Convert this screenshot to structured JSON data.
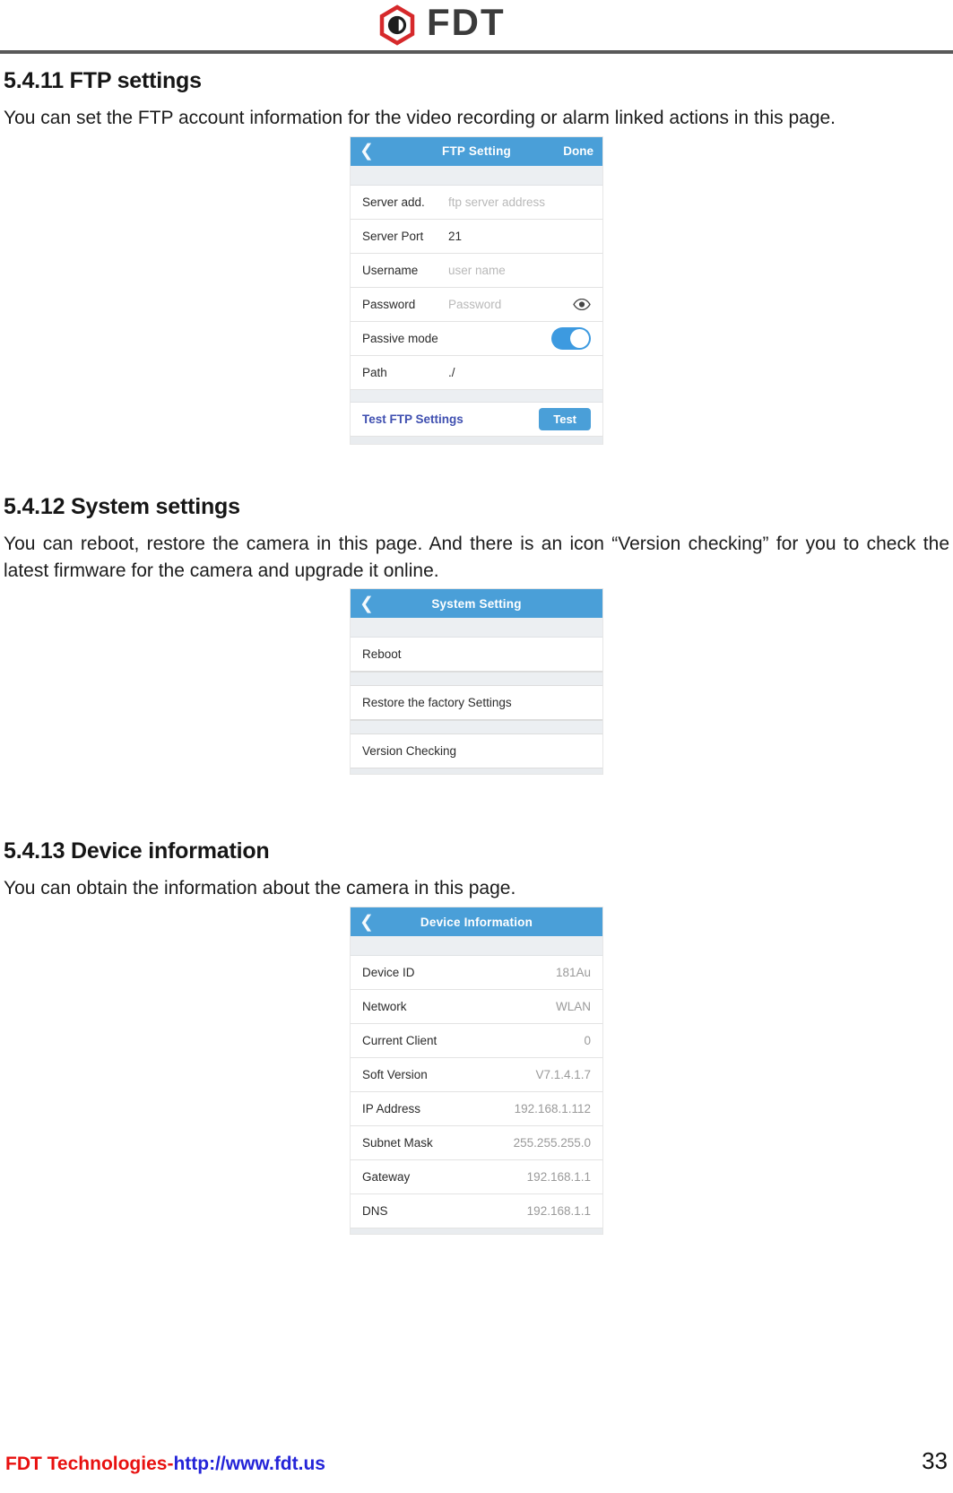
{
  "header": {
    "logo_text": "FDT",
    "logo_icon": "fdt-hexagon-logo-icon"
  },
  "sections": [
    {
      "heading": "5.4.11 FTP settings",
      "body": "You can set the FTP account information for the video recording or alarm linked actions in this page."
    },
    {
      "heading": "5.4.12 System settings",
      "body": "You can reboot, restore the camera in this page. And there is an icon “Version checking” for you to check the latest firmware for the camera and upgrade it online."
    },
    {
      "heading": "5.4.13 Device information",
      "body": "You can obtain the information about the camera in this page."
    }
  ],
  "ftp_screen": {
    "back_icon": "chevron-left-icon",
    "title": "FTP Setting",
    "done_label": "Done",
    "rows": [
      {
        "label": "Server add.",
        "placeholder": "ftp server address",
        "value": ""
      },
      {
        "label": "Server Port",
        "placeholder": "",
        "value": "21"
      },
      {
        "label": "Username",
        "placeholder": "user name",
        "value": ""
      },
      {
        "label": "Password",
        "placeholder": "Password",
        "value": "",
        "icon": "eye-icon"
      },
      {
        "label": "Passive mode",
        "placeholder": "",
        "value": "",
        "toggle": true,
        "toggle_on": true
      },
      {
        "label": "Path",
        "placeholder": "",
        "value": "./"
      }
    ],
    "test_row": {
      "label": "Test FTP Settings",
      "button_label": "Test"
    }
  },
  "system_screen": {
    "back_icon": "chevron-left-icon",
    "title": "System Setting",
    "items": [
      {
        "label": "Reboot"
      },
      {
        "label": "Restore the factory Settings"
      },
      {
        "label": "Version Checking"
      }
    ]
  },
  "device_screen": {
    "back_icon": "chevron-left-icon",
    "title": "Device Information",
    "rows": [
      {
        "label": "Device ID",
        "value": "181Au"
      },
      {
        "label": "Network",
        "value": "WLAN"
      },
      {
        "label": "Current Client",
        "value": "0"
      },
      {
        "label": "Soft Version",
        "value": "V7.1.4.1.7"
      },
      {
        "label": "IP Address",
        "value": "192.168.1.112"
      },
      {
        "label": "Subnet Mask",
        "value": "255.255.255.0"
      },
      {
        "label": "Gateway",
        "value": "192.168.1.1"
      },
      {
        "label": "DNS",
        "value": "192.168.1.1"
      }
    ]
  },
  "footer": {
    "company": "FDT Technologies-",
    "url": "http://www.fdt.us",
    "page_number": "33"
  },
  "colors": {
    "accent_blue": "#4a9fd8",
    "toggle_blue": "#3d9ae0",
    "brand_red": "#e8100f",
    "link_blue": "#2424d8",
    "action_indigo": "#3f4fb0"
  }
}
